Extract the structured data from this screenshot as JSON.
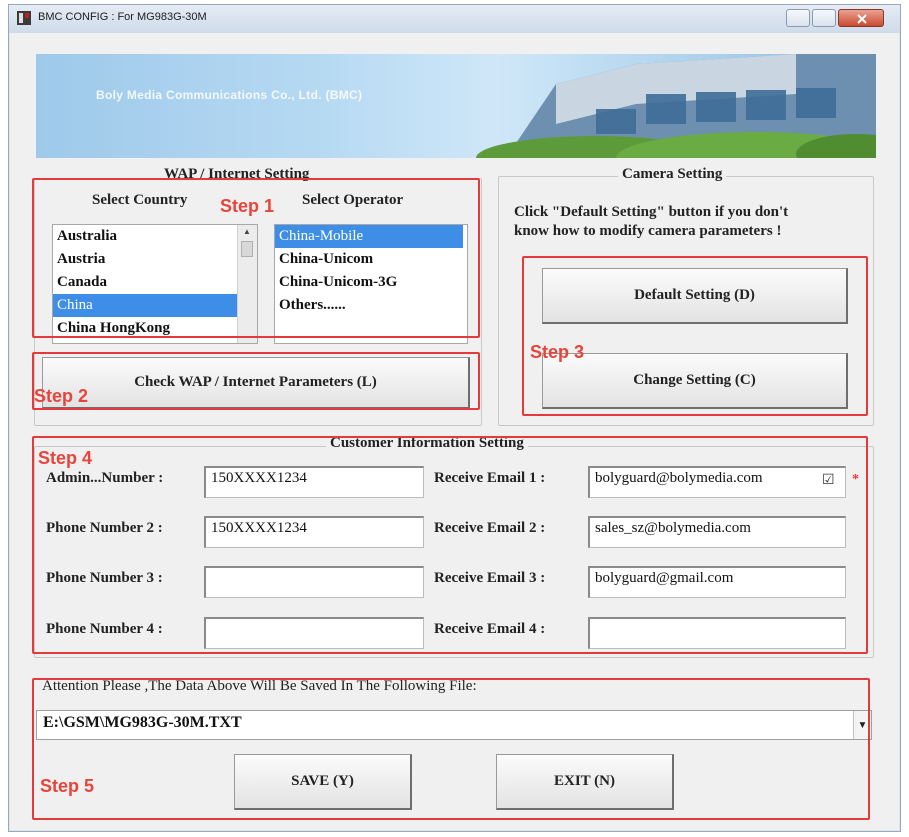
{
  "window": {
    "title": "BMC CONFIG : For MG983G-30M"
  },
  "banner": {
    "company_text": "Boly Media Communications Co., Ltd. (BMC)"
  },
  "wap": {
    "group_title": "WAP / Internet Setting",
    "country_label": "Select Country",
    "operator_label": "Select Operator",
    "countries": [
      "Australia",
      "Austria",
      "Canada",
      "China",
      "China HongKong"
    ],
    "selected_country": "China",
    "operators": [
      "China-Mobile",
      "China-Unicom",
      "China-Unicom-3G",
      "Others......"
    ],
    "selected_operator": "China-Mobile",
    "check_button": "Check WAP / Internet Parameters (L)"
  },
  "camera": {
    "group_title": "Camera Setting",
    "hint_line1": "Click \"Default Setting\" button if you don't",
    "hint_line2": "know how to modify camera parameters !",
    "default_button": "Default Setting (D)",
    "change_button": "Change Setting (C)"
  },
  "customer": {
    "group_title": "Customer Information Setting",
    "phones": [
      {
        "label": "Admin...Number :",
        "value": "150XXXX1234"
      },
      {
        "label": "Phone Number 2 :",
        "value": "150XXXX1234"
      },
      {
        "label": "Phone Number 3 :",
        "value": ""
      },
      {
        "label": "Phone Number 4 :",
        "value": ""
      }
    ],
    "emails": [
      {
        "label": "Receive Email 1 :",
        "value": "bolyguard@bolymedia.com"
      },
      {
        "label": "Receive Email 2 :",
        "value": "sales_sz@bolymedia.com"
      },
      {
        "label": "Receive Email 3 :",
        "value": "bolyguard@gmail.com"
      },
      {
        "label": "Receive Email 4 :",
        "value": ""
      }
    ],
    "email1_checkbox": "☑",
    "email1_mark": "*"
  },
  "save": {
    "attention_text": "Attention Please ,The Data Above Will Be Saved In The Following File:",
    "file_path": "E:\\GSM\\MG983G-30M.TXT",
    "save_button": "SAVE (Y)",
    "exit_button": "EXIT (N)"
  },
  "steps": {
    "step1": "Step 1",
    "step2": "Step 2",
    "step3": "Step 3",
    "step4": "Step 4",
    "step5": "Step 5"
  },
  "colors": {
    "annotation": "#e53a3a",
    "selection": "#3e8ee8",
    "window_bg": "#f0f0f0"
  }
}
